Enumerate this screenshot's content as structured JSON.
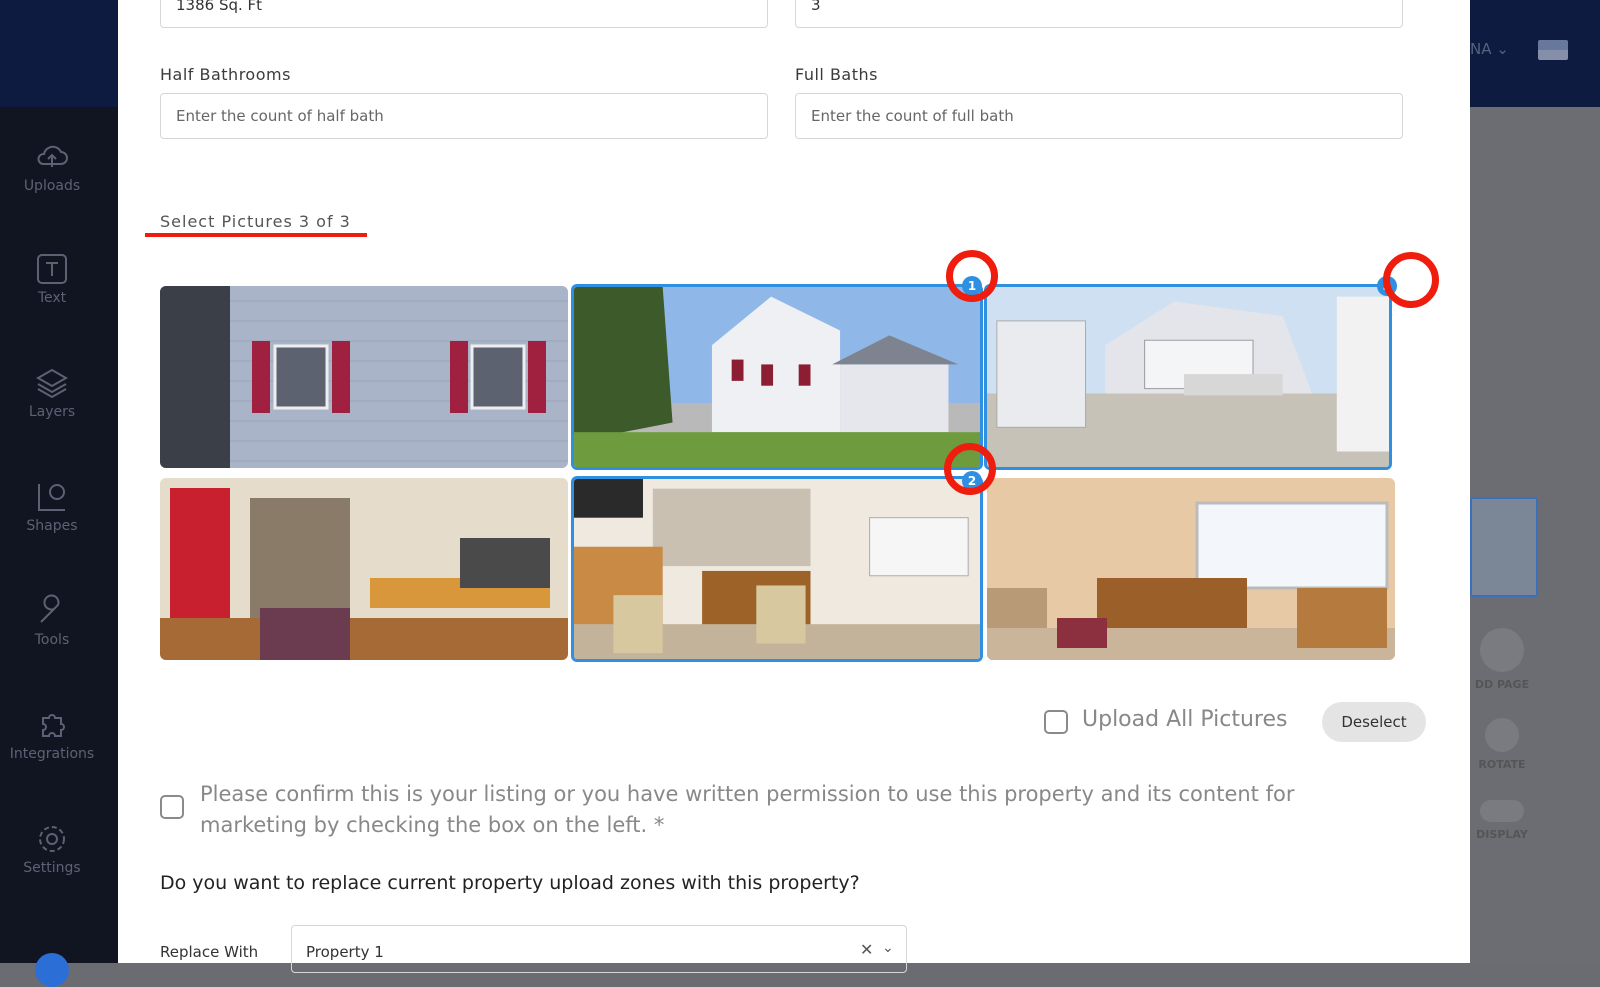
{
  "background": {
    "lang_code": "NA",
    "sidebar_items": [
      {
        "label": "Uploads",
        "icon": "cloud-upload-icon"
      },
      {
        "label": "Text",
        "icon": "text-icon"
      },
      {
        "label": "Layers",
        "icon": "layers-icon"
      },
      {
        "label": "Shapes",
        "icon": "shapes-icon"
      },
      {
        "label": "Tools",
        "icon": "wrench-icon"
      },
      {
        "label": "Integrations",
        "icon": "puzzle-icon"
      },
      {
        "label": "Settings",
        "icon": "gear-icon"
      }
    ],
    "right_panel": {
      "add_page": "DD PAGE",
      "rotate": "ROTATE",
      "display": "DISPLAY"
    }
  },
  "form": {
    "sqft_value": "1386 Sq. Ft",
    "bedrooms_value": "3",
    "half_bath_label": "Half Bathrooms",
    "half_bath_placeholder": "Enter the count of half bath",
    "full_bath_label": "Full Baths",
    "full_bath_placeholder": "Enter the count of full bath"
  },
  "pictures": {
    "title": "Select Pictures 3 of 3",
    "items": [
      {
        "selected": false,
        "order": ""
      },
      {
        "selected": true,
        "order": "1"
      },
      {
        "selected": true,
        "order": "3"
      },
      {
        "selected": false,
        "order": ""
      },
      {
        "selected": true,
        "order": "2"
      },
      {
        "selected": false,
        "order": ""
      }
    ],
    "upload_all_label": "Upload All Pictures",
    "deselect_label": "Deselect"
  },
  "confirm_text": "Please confirm this is your listing or you have written permission to use this property and its content for marketing by checking the box on the left. *",
  "replace": {
    "question": "Do you want to replace current property upload zones with this property?",
    "label": "Replace With",
    "value": "Property 1",
    "clear_glyph": "✕",
    "chevron_glyph": "⌄"
  },
  "colors": {
    "accent": "#2f8fe0",
    "annotation_red": "#ee1d0e",
    "topbar": "#0c1b3f",
    "sidebar": "#101521"
  }
}
